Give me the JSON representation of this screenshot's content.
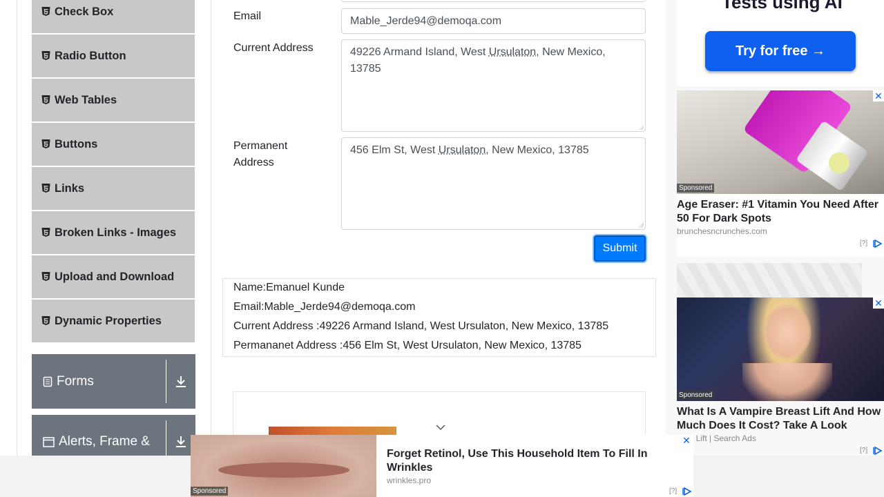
{
  "sidebar": {
    "items": [
      {
        "label": "Check Box"
      },
      {
        "label": "Radio Button"
      },
      {
        "label": "Web Tables"
      },
      {
        "label": "Buttons"
      },
      {
        "label": "Links"
      },
      {
        "label": "Broken Links - Images"
      },
      {
        "label": "Upload and Download"
      },
      {
        "label": "Dynamic Properties"
      }
    ],
    "groups": [
      {
        "label": "Forms",
        "icon": "document-icon"
      },
      {
        "label": "Alerts, Frame &",
        "icon": "window-icon"
      }
    ]
  },
  "form": {
    "email_label": "Email",
    "email_value": "Mable_Jerde94@demoqa.com",
    "current_label": "Current Address",
    "current_value_a": "49226 Armand Island, West ",
    "current_value_u": "Ursulaton",
    "current_value_b": ", New Mexico, 13785",
    "permanent_label": "Permanent Address",
    "permanent_value_a": "456 Elm St, West ",
    "permanent_value_u": "Ursulaton",
    "permanent_value_b": ", New Mexico, 13785",
    "submit_label": "Submit"
  },
  "output": {
    "name": "Name:Emanuel Kunde",
    "email": "Email:Mable_Jerde94@demoqa.com",
    "current": "Current Address :49226 Armand Island, West Ursulaton, New Mexico, 13785",
    "permanent": "Permananet Address :456 Elm St, West Ursulaton, New Mexico, 13785"
  },
  "ads": {
    "cta_headline": "Tests using AI",
    "cta_button": "Try for free →",
    "card1": {
      "sponsored": "Sponsored",
      "title": "Age Eraser: #1 Vitamin You Need After 50 For Dark Spots",
      "source": "brunchesncrunches.com",
      "info": "[?]"
    },
    "card2": {
      "sponsored": "Sponsored",
      "title": "What Is A Vampire Breast Lift And How Much Does It Cost? Take A Look",
      "source": "st Lift | Search Ads",
      "info": "[?]"
    },
    "bottom": {
      "sponsored": "Sponsored",
      "title": "Forget Retinol, Use This Household Item To Fill In Wrinkles",
      "source": "wrinkles.pro",
      "info": "[?]"
    }
  },
  "colors": {
    "accent": "#007bff",
    "sidebar_item": "#c8c8c8",
    "group": "#6c757d"
  }
}
